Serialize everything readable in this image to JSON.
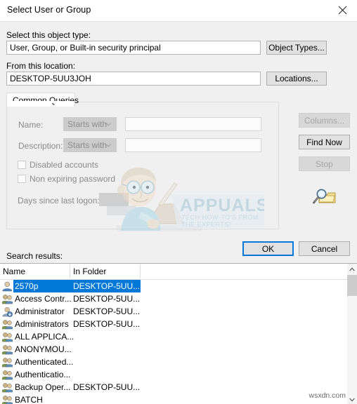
{
  "window": {
    "title": "Select User or Group",
    "close_icon": "close-icon"
  },
  "object_type": {
    "label": "Select this object type:",
    "value": "User, Group, or Built-in security principal",
    "button": "Object Types..."
  },
  "location": {
    "label": "From this location:",
    "value": "DESKTOP-5UU3JOH",
    "button": "Locations..."
  },
  "tabs": [
    {
      "label": "Common Queries",
      "active": true
    }
  ],
  "query": {
    "name_label": "Name:",
    "name_operator": "Starts with",
    "name_value": "",
    "description_label": "Description:",
    "description_operator": "Starts with",
    "description_value": "",
    "disabled_accounts_label": "Disabled accounts",
    "disabled_accounts_checked": false,
    "non_expiring_password_label": "Non expiring password",
    "non_expiring_password_checked": false,
    "days_since_logon_label": "Days since last logon:",
    "days_since_logon_value": ""
  },
  "actions": {
    "columns": "Columns...",
    "columns_enabled": false,
    "find_now": "Find Now",
    "find_now_enabled": true,
    "stop": "Stop",
    "stop_enabled": false,
    "find_icon": "magnifier-folder-icon"
  },
  "dialog_buttons": {
    "ok": "OK",
    "cancel": "Cancel"
  },
  "results": {
    "label": "Search results:",
    "columns": [
      "Name",
      "In Folder"
    ],
    "rows": [
      {
        "name": "2570p",
        "folder": "DESKTOP-5UU...",
        "icon": "user-icon",
        "selected": true
      },
      {
        "name": "Access Contr...",
        "folder": "DESKTOP-5UU...",
        "icon": "group-icon",
        "selected": false
      },
      {
        "name": "Administrator",
        "folder": "DESKTOP-5UU...",
        "icon": "user-download-icon",
        "selected": false
      },
      {
        "name": "Administrators",
        "folder": "DESKTOP-5UU...",
        "icon": "group-icon",
        "selected": false
      },
      {
        "name": "ALL APPLICA...",
        "folder": "",
        "icon": "group-icon",
        "selected": false
      },
      {
        "name": "ANONYMOU...",
        "folder": "",
        "icon": "group-icon",
        "selected": false
      },
      {
        "name": "Authenticated...",
        "folder": "",
        "icon": "group-icon",
        "selected": false
      },
      {
        "name": "Authenticatio...",
        "folder": "",
        "icon": "group-icon",
        "selected": false
      },
      {
        "name": "Backup Oper...",
        "folder": "DESKTOP-5UU...",
        "icon": "group-icon",
        "selected": false
      },
      {
        "name": "BATCH",
        "folder": "",
        "icon": "group-icon",
        "selected": false
      }
    ],
    "scrollbar": {
      "up_icon": "chevron-up-icon",
      "down_icon": "chevron-down-icon"
    }
  },
  "watermarks": {
    "appuals_title": "APPUALS",
    "appuals_tagline_1": "TECH HOW-TO'S FROM",
    "appuals_tagline_2": "THE EXPERTS!",
    "corner": "wsxdn.com"
  },
  "colors": {
    "accent": "#0078d7",
    "dialog_bg": "#f0f0f0",
    "button_face": "#e1e1e1",
    "disabled_text": "#a5a5a5"
  }
}
